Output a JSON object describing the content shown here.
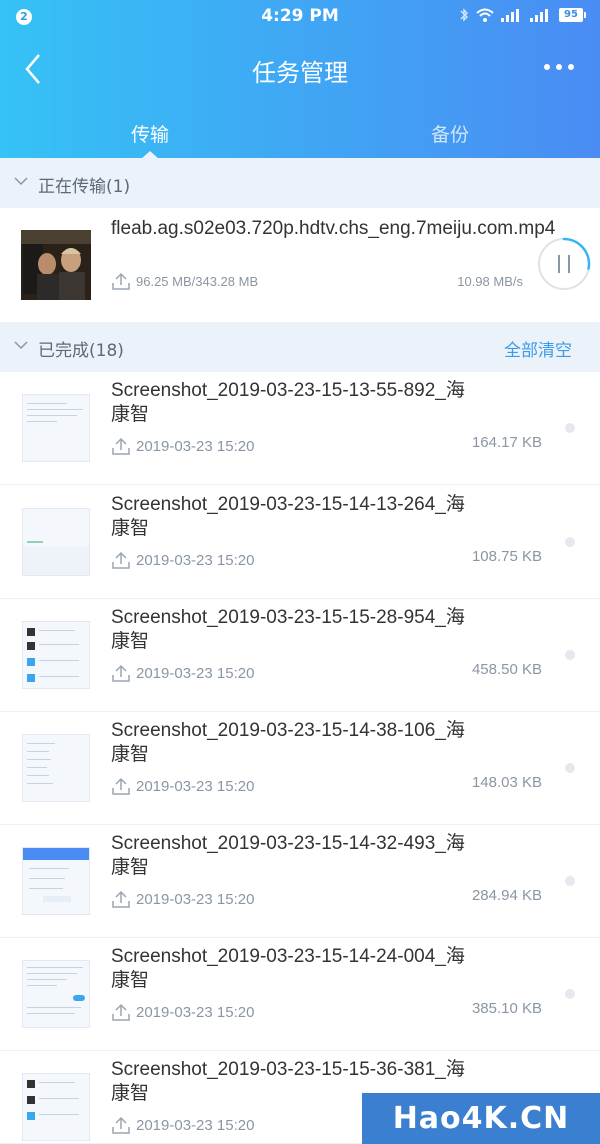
{
  "status_bar": {
    "notification_count": "2",
    "time": "4:29 PM",
    "battery": "95"
  },
  "header": {
    "title": "任务管理",
    "tabs": [
      {
        "label": "传输",
        "active": true
      },
      {
        "label": "备份",
        "active": false
      }
    ]
  },
  "active_section": {
    "title": "正在传输",
    "count": "(1)"
  },
  "active_transfer": {
    "name": "fleab.ag.s02e03.720p.hdtv.chs_eng.7meiju.com.mp4",
    "progress_text": "96.25 MB/343.28 MB",
    "speed": "10.98 MB/s",
    "progress_fraction": 0.28
  },
  "completed_section": {
    "title": "已完成",
    "count": "(18)",
    "clear_all": "全部清空"
  },
  "completed": [
    {
      "name": "Screenshot_2019-03-23-15-13-55-892_海康智",
      "date": "2019-03-23 15:20",
      "size": "164.17 KB"
    },
    {
      "name": "Screenshot_2019-03-23-15-14-13-264_海康智",
      "date": "2019-03-23 15:20",
      "size": "108.75 KB"
    },
    {
      "name": "Screenshot_2019-03-23-15-15-28-954_海康智",
      "date": "2019-03-23 15:20",
      "size": "458.50 KB"
    },
    {
      "name": "Screenshot_2019-03-23-15-14-38-106_海康智",
      "date": "2019-03-23 15:20",
      "size": "148.03 KB"
    },
    {
      "name": "Screenshot_2019-03-23-15-14-32-493_海康智",
      "date": "2019-03-23 15:20",
      "size": "284.94 KB"
    },
    {
      "name": "Screenshot_2019-03-23-15-14-24-004_海康智",
      "date": "2019-03-23 15:20",
      "size": "385.10 KB"
    },
    {
      "name": "Screenshot_2019-03-23-15-15-36-381_海康智",
      "date": "2019-03-23 15:20",
      "size": ""
    }
  ],
  "watermark": "Hao4K.CN",
  "colors": {
    "header_start": "#35c2f5",
    "header_end": "#4a8cf4",
    "accent": "#3a9be8",
    "section_bg": "#ecf2f9"
  }
}
